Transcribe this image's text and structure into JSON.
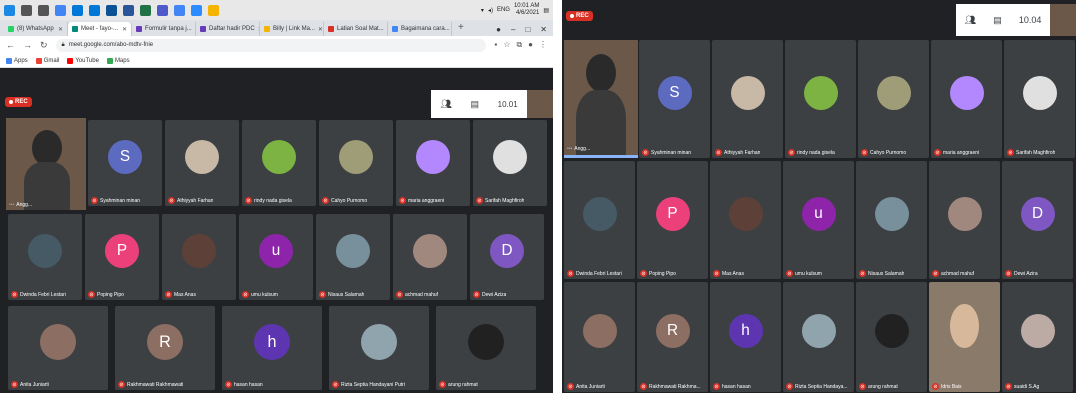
{
  "taskbar": {
    "time": "10:01 AM",
    "date": "4/6/2021",
    "lang": "ENG",
    "icons": [
      "windows-icon",
      "search-icon",
      "task-view-icon",
      "chrome-icon",
      "edge-icon",
      "store-icon",
      "mail-icon",
      "word-icon",
      "excel-icon",
      "teams-icon",
      "chrome-icon",
      "zoom-icon",
      "explorer-icon"
    ]
  },
  "browser": {
    "tabs": [
      {
        "label": "(8) WhatsApp",
        "color": "#25d366"
      },
      {
        "label": "Meet - fayo-...",
        "color": "#00897b",
        "active": true
      },
      {
        "label": "Formulir tanpa j...",
        "color": "#673ab7"
      },
      {
        "label": "Daftar hadir PDC",
        "color": "#673ab7"
      },
      {
        "label": "Billy | Link Ma...",
        "color": "#f4b400"
      },
      {
        "label": "Latian Soal Mat...",
        "color": "#d93025"
      },
      {
        "label": "Bagaimana cara...",
        "color": "#4285f4"
      }
    ],
    "new_tab": "+",
    "url": "meet.google.com/abo-mdtv-fnie",
    "bookmarks": [
      {
        "label": "Apps",
        "color": "#4285f4"
      },
      {
        "label": "Gmail",
        "color": "#ea4335"
      },
      {
        "label": "YouTube",
        "color": "#ff0000"
      },
      {
        "label": "Maps",
        "color": "#34a853"
      }
    ]
  },
  "left_meet": {
    "rec": "REC",
    "time": "10.01",
    "self_name": "Angg...",
    "participants": [
      {
        "name": "Syahminan minan",
        "initial": "S",
        "color": "#5c6bc0",
        "avatar": "letter"
      },
      {
        "name": "Athiyyah Farhan",
        "initial": "",
        "color": "#c8b8a6",
        "avatar": "photo"
      },
      {
        "name": "rindy nada gisela",
        "initial": "",
        "color": "#7cb342",
        "avatar": "photo"
      },
      {
        "name": "Cahyo Purnomo",
        "initial": "",
        "color": "#9e9d77",
        "avatar": "photo"
      },
      {
        "name": "maria anggraeni",
        "initial": "",
        "color": "#b388ff",
        "avatar": "photo"
      },
      {
        "name": "Sarifah Maghfiroh",
        "initial": "",
        "color": "#e0e0e0",
        "avatar": "photo"
      },
      {
        "name": "Dwinda Febri Lestari",
        "initial": "",
        "color": "#455a64",
        "avatar": "photo"
      },
      {
        "name": "Poping Pipo",
        "initial": "P",
        "color": "#ec407a",
        "avatar": "letter"
      },
      {
        "name": "Mas Anas",
        "initial": "",
        "color": "#5d4037",
        "avatar": "photo"
      },
      {
        "name": "umu kulsum",
        "initial": "u",
        "color": "#8e24aa",
        "avatar": "letter"
      },
      {
        "name": "Nisaus Salamah",
        "initial": "",
        "color": "#78909c",
        "avatar": "photo"
      },
      {
        "name": "achmad mahuf",
        "initial": "",
        "color": "#a1887f",
        "avatar": "photo"
      },
      {
        "name": "Dewi Aziza",
        "initial": "D",
        "color": "#7e57c2",
        "avatar": "letter"
      },
      {
        "name": "Anita Juniarti",
        "initial": "",
        "color": "#8d6e63",
        "avatar": "photo"
      },
      {
        "name": "Rakhmawati Rakhmawati",
        "initial": "R",
        "color": "#8d6e63",
        "avatar": "letter"
      },
      {
        "name": "hasan hasan",
        "initial": "h",
        "color": "#5e35b1",
        "avatar": "letter"
      },
      {
        "name": "Rizta Septia Handayani Putri",
        "initial": "",
        "color": "#90a4ae",
        "avatar": "photo"
      },
      {
        "name": "arung rahmat",
        "initial": "",
        "color": "#212121",
        "avatar": "photo"
      }
    ]
  },
  "right_meet": {
    "rec": "REC",
    "time": "10.04",
    "self_name": "Angg...",
    "participants": [
      {
        "name": "Syahminan minan",
        "initial": "S",
        "color": "#5c6bc0",
        "avatar": "letter"
      },
      {
        "name": "Athiyyah Farhan",
        "initial": "",
        "color": "#c8b8a6",
        "avatar": "photo"
      },
      {
        "name": "rindy nada gisela",
        "initial": "",
        "color": "#7cb342",
        "avatar": "photo"
      },
      {
        "name": "Cahyo Purnomo",
        "initial": "",
        "color": "#9e9d77",
        "avatar": "photo"
      },
      {
        "name": "maria anggraeni",
        "initial": "",
        "color": "#b388ff",
        "avatar": "photo"
      },
      {
        "name": "Sarifah Maghfiroh",
        "initial": "",
        "color": "#e0e0e0",
        "avatar": "photo"
      },
      {
        "name": "Dwinda Febri Lestari",
        "initial": "",
        "color": "#455a64",
        "avatar": "photo"
      },
      {
        "name": "Poping Pipo",
        "initial": "P",
        "color": "#ec407a",
        "avatar": "letter"
      },
      {
        "name": "Mas Anas",
        "initial": "",
        "color": "#5d4037",
        "avatar": "photo"
      },
      {
        "name": "umu kulsum",
        "initial": "u",
        "color": "#8e24aa",
        "avatar": "letter"
      },
      {
        "name": "Nisaus Salamah",
        "initial": "",
        "color": "#78909c",
        "avatar": "photo"
      },
      {
        "name": "achmad mahuf",
        "initial": "",
        "color": "#a1887f",
        "avatar": "photo"
      },
      {
        "name": "Dewi Azira",
        "initial": "D",
        "color": "#7e57c2",
        "avatar": "letter"
      },
      {
        "name": "Anita Juniarti",
        "initial": "",
        "color": "#8d6e63",
        "avatar": "photo"
      },
      {
        "name": "Rakhmawati Rakhma...",
        "initial": "R",
        "color": "#8d6e63",
        "avatar": "letter"
      },
      {
        "name": "hasan hasan",
        "initial": "h",
        "color": "#5e35b1",
        "avatar": "letter"
      },
      {
        "name": "Rizta Septia Handaya...",
        "initial": "",
        "color": "#90a4ae",
        "avatar": "photo"
      },
      {
        "name": "arung rahmat",
        "initial": "",
        "color": "#212121",
        "avatar": "photo"
      },
      {
        "name": "Idris Bais",
        "initial": "",
        "color": "#8a7a6a",
        "avatar": "video"
      },
      {
        "name": "suaidi S.Ag",
        "initial": "",
        "color": "#bcaaa4",
        "avatar": "photo"
      }
    ]
  }
}
